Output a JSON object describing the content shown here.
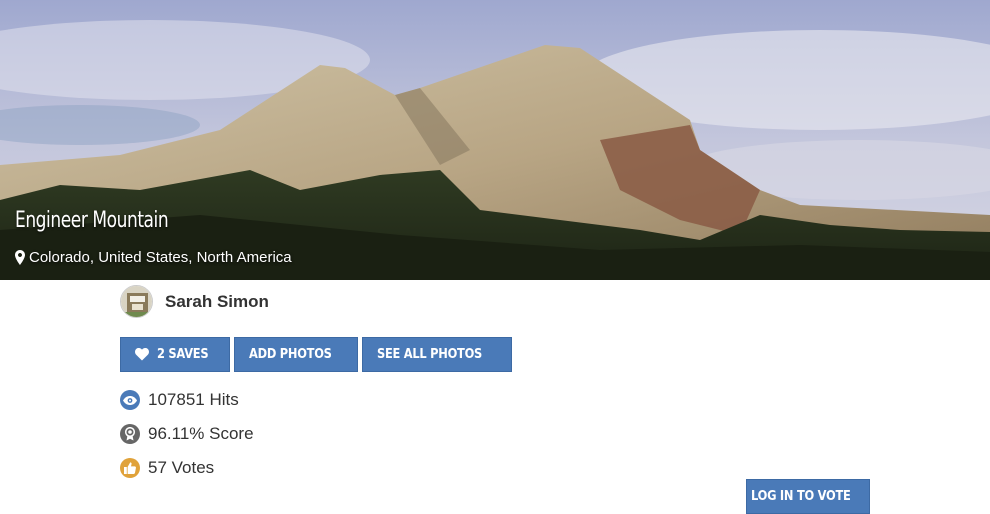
{
  "hero": {
    "title": "Engineer Mountain",
    "location": "Colorado, United States, North America"
  },
  "author": {
    "name": "Sarah Simon"
  },
  "actions": {
    "saves_label": "2 SAVES",
    "add_photos_label": "ADD PHOTOS",
    "see_all_photos_label": "SEE ALL PHOTOS"
  },
  "stats": {
    "hits": "107851 Hits",
    "score": "96.11% Score",
    "votes": "57 Votes"
  },
  "vote": {
    "login_label": "LOG IN TO VOTE"
  },
  "colors": {
    "button": "#4a7ab8",
    "hits_icon": "#4a7ab8",
    "score_icon": "#666666",
    "votes_icon": "#e0a23a"
  },
  "icons": {
    "location": "map-pin-icon",
    "saves": "heart-icon",
    "hits": "eye-icon",
    "score": "award-icon",
    "votes": "thumbs-up-icon"
  }
}
